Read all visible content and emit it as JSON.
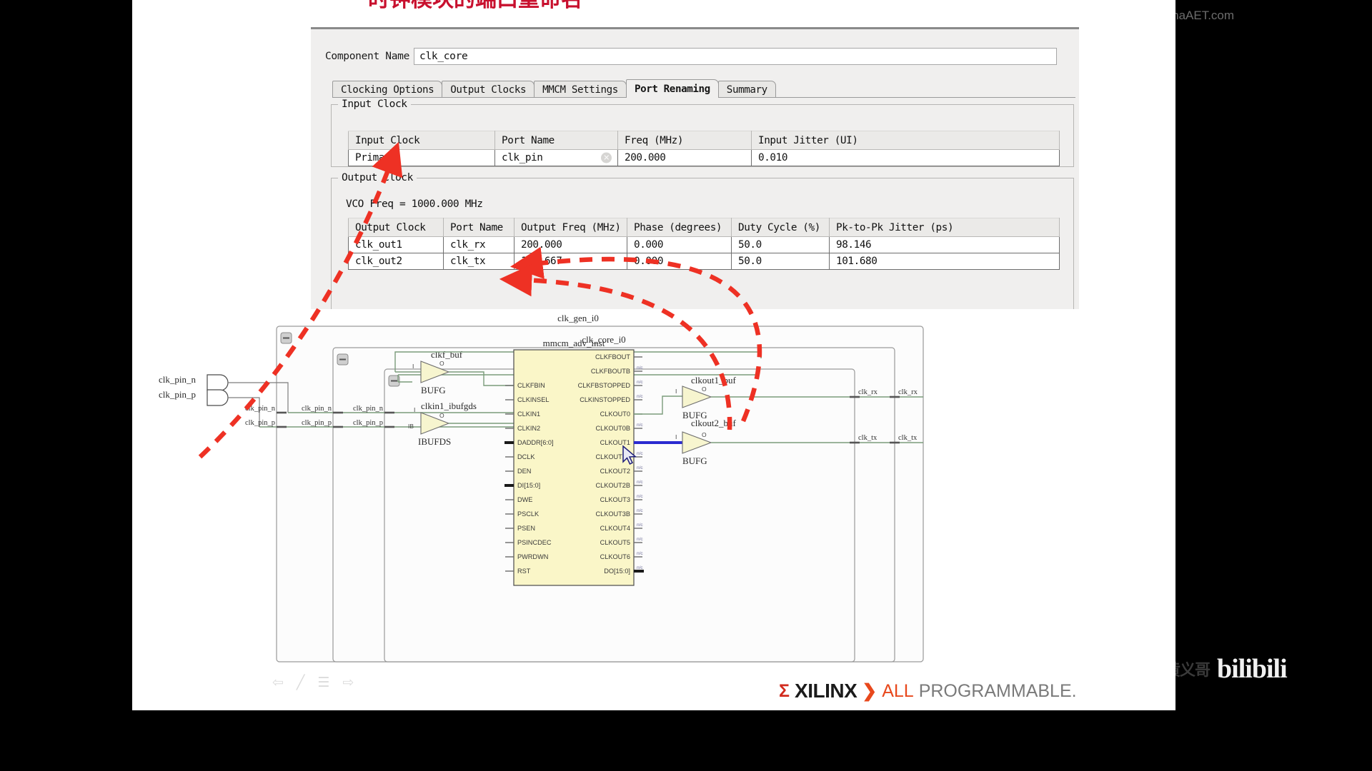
{
  "slide": {
    "title_fragment": "时钟模块的端口重命名"
  },
  "dialog": {
    "component_name_label": "Component Name",
    "component_name_value": "clk_core",
    "tabs": [
      {
        "label": "Clocking Options",
        "active": false
      },
      {
        "label": "Output Clocks",
        "active": false
      },
      {
        "label": "MMCM Settings",
        "active": false
      },
      {
        "label": "Port Renaming",
        "active": true
      },
      {
        "label": "Summary",
        "active": false
      }
    ],
    "input_clock_group": {
      "title": "Input Clock",
      "headers": [
        "Input Clock",
        "Port Name",
        "Freq (MHz)",
        "Input Jitter (UI)"
      ],
      "rows": [
        {
          "input_clock": "Primary",
          "port_name": "clk_pin",
          "freq": "200.000",
          "jitter": "0.010"
        }
      ]
    },
    "output_clock_group": {
      "title": "Output Clock",
      "vco_freq": "VCO Freq = 1000.000 MHz",
      "headers": [
        "Output Clock",
        "Port Name",
        "Output Freq (MHz)",
        "Phase (degrees)",
        "Duty Cycle (%)",
        "Pk-to-Pk Jitter (ps)"
      ],
      "rows": [
        {
          "output_clock": "clk_out1",
          "port_name": "clk_rx",
          "freq": "200.000",
          "phase": "0.000",
          "duty": "50.0",
          "jitter": "98.146"
        },
        {
          "output_clock": "clk_out2",
          "port_name": "clk_tx",
          "freq": "166.667",
          "phase": "0.000",
          "duty": "50.0",
          "jitter": "101.680"
        }
      ]
    }
  },
  "schematic": {
    "hierarchy": {
      "outer_block": "clk_gen_i0",
      "middle_block": "clk_core_i0",
      "inner_block": "inst"
    },
    "external_pins": [
      {
        "name": "clk_pin_n"
      },
      {
        "name": "clk_pin_p"
      }
    ],
    "net_labels_left": [
      [
        "clk_pin_n",
        "clk_pin_n",
        "clk_pin_n"
      ],
      [
        "clk_pin_p",
        "clk_pin_p",
        "clk_pin_p"
      ]
    ],
    "buffers": [
      {
        "name": "clkf_buf",
        "type": "BUFG",
        "in": "I",
        "out": "O"
      },
      {
        "name": "clkin1_ibufgds",
        "type": "IBUFDS",
        "in": "I",
        "in2": "IB",
        "out": "O"
      },
      {
        "name": "clkout1_buf",
        "type": "BUFG",
        "in": "I",
        "out": "O"
      },
      {
        "name": "clkout2_buf",
        "type": "BUFG",
        "in": "I",
        "out": "O"
      }
    ],
    "mmcm": {
      "name": "mmcm_adv_inst",
      "inputs": [
        "CLKFBIN",
        "CLKINSEL",
        "CLKIN1",
        "CLKIN2",
        "DADDR[6:0]",
        "DCLK",
        "DEN",
        "DI[15:0]",
        "DWE",
        "PSCLK",
        "PSEN",
        "PSINCDEC",
        "PWRDWN",
        "RST"
      ],
      "outputs": [
        "CLKFBOUT",
        "CLKFBOUTB",
        "CLKFBSTOPPED",
        "CLKINSTOPPED",
        "CLKOUT0",
        "CLKOUT0B",
        "CLKOUT1",
        "CLKOUT1B",
        "CLKOUT2",
        "CLKOUT2B",
        "CLKOUT3",
        "CLKOUT3B",
        "CLKOUT4",
        "CLKOUT5",
        "CLKOUT6",
        "DO[15:0]"
      ],
      "unconnected_marker": "n/c"
    },
    "net_labels_right": [
      [
        "clk_rx",
        "clk_rx"
      ],
      [
        "clk_tx",
        "clk_tx"
      ]
    ],
    "colors": {
      "mmcm_fill": "#faf6c8",
      "buffer_fill": "#f7f5cf",
      "wire": "#7b9c7b",
      "highlight_net": "#2b2bd0",
      "annotation": "#ee3124"
    }
  },
  "footer": {
    "brand_sigma": "Σ",
    "brand_name": "XILINX",
    "brand_arrow": "❯",
    "brand_all": "ALL",
    "brand_programmable": "PROGRAMMABLE."
  },
  "watermarks": {
    "aet": "AET",
    "aet_site": "www.ChinaAET.com",
    "bilibili_cn": "黄义哥",
    "bilibili": "bilibili"
  }
}
